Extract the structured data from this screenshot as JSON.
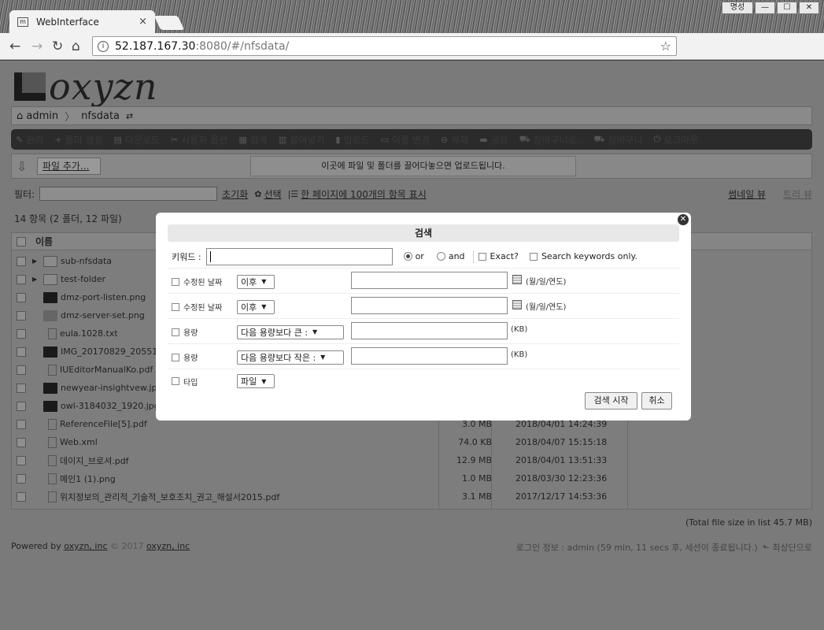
{
  "browser": {
    "tab_title": "WebInterface",
    "tab_close": "×",
    "profile": "명성",
    "url_host": "52.187.167.30",
    "url_rest": ":8080/#/nfsdata/"
  },
  "header": {
    "logo_text": "oxyzn"
  },
  "breadcrumb": {
    "root": "admin",
    "current": "nfsdata"
  },
  "menu": {
    "items": [
      "관리",
      "폴더 생성",
      "다운로드",
      "사용자 옵션",
      "검색",
      "붙여넣기",
      "업로드",
      "이름 변경",
      "삭제",
      "공유",
      "장바구니로..",
      "장바구니",
      "로그아웃"
    ]
  },
  "upload": {
    "add_files": "파일 추가...",
    "drop_hint": "이곳에 파일 및 폴더를 끌어다놓으면 업로드됩니다."
  },
  "filter": {
    "label": "필터:",
    "reset": "초기화",
    "select": "선택",
    "per_page": "한 페이지에 100개의 항목 표시",
    "thumb_view": "썸네일 뷰",
    "list_view": "트리 뷰"
  },
  "list": {
    "count": "14 항목 (2 폴더, 12 파일)",
    "col_name": "이름",
    "rows": [
      {
        "name": "sub-nfsdata",
        "size": "",
        "date": ""
      },
      {
        "name": "test-folder",
        "size": "",
        "date": ""
      },
      {
        "name": "dmz-port-listen.png",
        "size": "",
        "date": ""
      },
      {
        "name": "dmz-server-set.png",
        "size": "",
        "date": ""
      },
      {
        "name": "eula.1028.txt",
        "size": "",
        "date": ""
      },
      {
        "name": "IMG_20170829_20551",
        "size": "",
        "date": ""
      },
      {
        "name": "IUEditorManualKo.pdf",
        "size": "",
        "date": ""
      },
      {
        "name": "newyear-insightvew.jpg",
        "size": "",
        "date": ""
      },
      {
        "name": "owl-3184032_1920.jpg",
        "size": "",
        "date": ""
      },
      {
        "name": "ReferenceFile[5].pdf",
        "size": "3.0 MB",
        "date": "2018/04/01 14:24:39"
      },
      {
        "name": "Web.xml",
        "size": "74.0 KB",
        "date": "2018/04/07 15:15:18"
      },
      {
        "name": "데이지_브로셔.pdf",
        "size": "12.9 MB",
        "date": "2018/04/01 13:51:33"
      },
      {
        "name": "메인1 (1).png",
        "size": "1.0 MB",
        "date": "2018/03/30 12:23:36"
      },
      {
        "name": "위치정보의_관리적_기술적_보호조치_권고_해설서2015.pdf",
        "size": "3.1 MB",
        "date": "2017/12/17 14:53:36"
      }
    ],
    "total": "(Total file size in list 45.7 MB)"
  },
  "footer": {
    "powered": "Powered by",
    "brand": "oxyzn, inc",
    "copy": "© 2017",
    "brand2": "oxyzn, inc",
    "login_info": "로그인 정보 : admin (59 min, 11 secs 후, 세션이 종료됩니다.)",
    "home": "최상단으로"
  },
  "search": {
    "title": "검색",
    "keyword_label": "키워드 :",
    "or": "or",
    "and": "and",
    "exact": "Exact?",
    "keywords_only": "Search keywords only.",
    "modified_label": "수정된 날짜",
    "after": "이후",
    "date_hint": "(월/일/연도)",
    "size_label": "용량",
    "larger": "다음 용량보다 큰 :",
    "smaller": "다음 용량보다 작은 :",
    "kb": "(KB)",
    "type_label": "타입",
    "type_value": "파일",
    "start": "검색 시작",
    "cancel": "취소"
  }
}
